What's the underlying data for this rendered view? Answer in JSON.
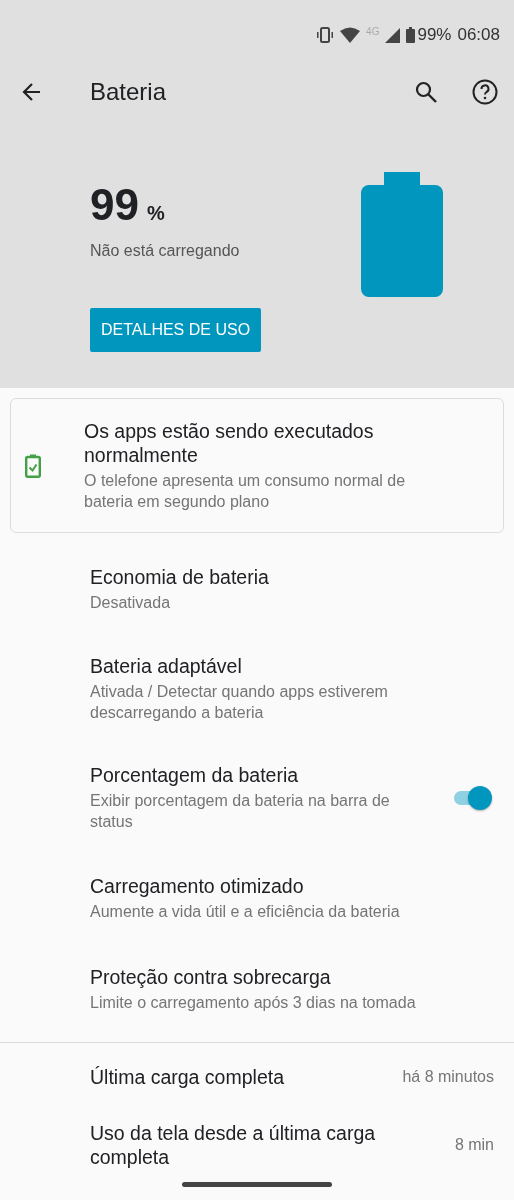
{
  "status_bar": {
    "network": "4G",
    "battery": "99%",
    "time": "06:08"
  },
  "toolbar": {
    "title": "Bateria"
  },
  "summary": {
    "percent": "99",
    "unit": "%",
    "state": "Não está carregando",
    "button": "DETALHES DE USO"
  },
  "tip": {
    "title": "Os apps estão sendo executados normalmente",
    "subtitle": "O telefone apresenta um consumo normal de bateria em segundo plano"
  },
  "settings": [
    {
      "kind": "plain",
      "title": "Economia de bateria",
      "subtitle": "Desativada"
    },
    {
      "kind": "plain",
      "title": "Bateria adaptável",
      "subtitle": "Ativada / Detectar quando apps estiverem descarregando a bateria"
    },
    {
      "kind": "toggle",
      "title": "Porcentagem da bateria",
      "subtitle": "Exibir porcentagem da bateria na barra de status",
      "on": true
    },
    {
      "kind": "plain",
      "title": "Carregamento otimizado",
      "subtitle": "Aumente a vida útil e a eficiência da bateria"
    },
    {
      "kind": "plain",
      "title": "Proteção contra sobrecarga",
      "subtitle": "Limite o carregamento após 3 dias na tomada"
    }
  ],
  "usage": [
    {
      "label": "Última carga completa",
      "value": "há 8 minutos"
    },
    {
      "label": "Uso da tela desde a última carga completa",
      "value": "8 min"
    }
  ]
}
